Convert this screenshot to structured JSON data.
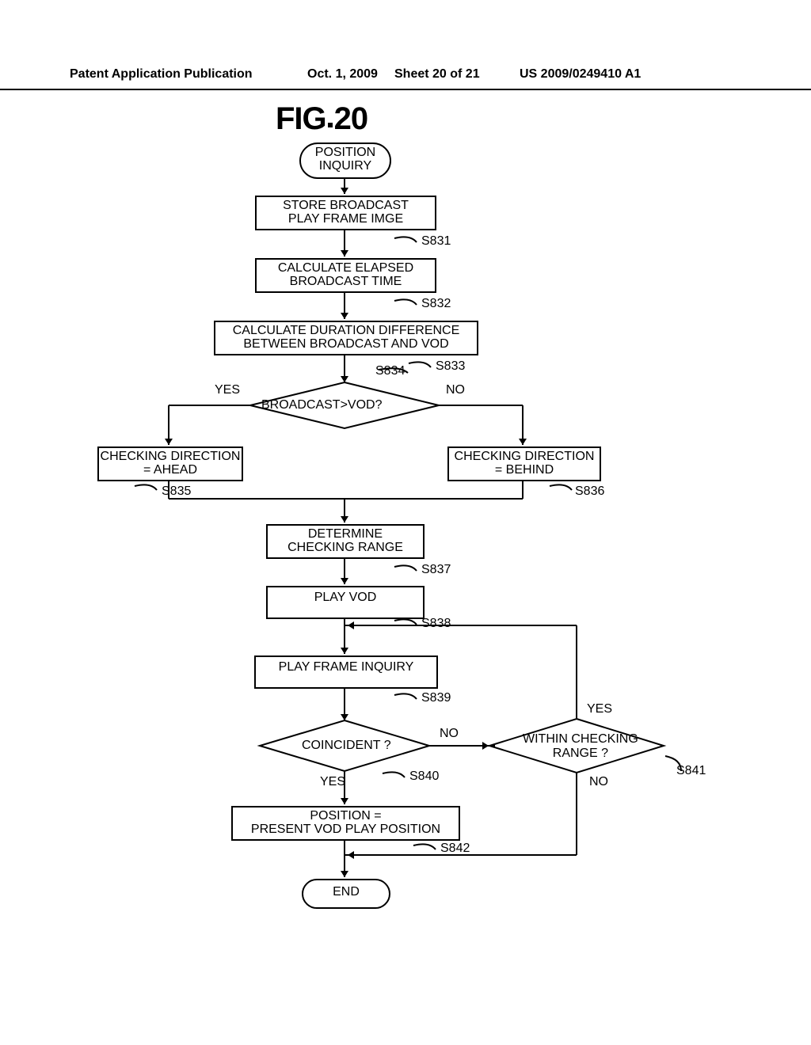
{
  "header": {
    "left": "Patent Application Publication",
    "center": "Oct. 1, 2009",
    "sheet": "Sheet 20 of 21",
    "pubno": "US 2009/0249410 A1"
  },
  "fig": {
    "prefix": "FIG",
    "num": "20"
  },
  "nodes": {
    "start": "POSITION\nINQUIRY",
    "n1": "STORE BROADCAST\nPLAY FRAME IMGE",
    "n2": "CALCULATE ELAPSED\nBROADCAST TIME",
    "n3": "CALCULATE DURATION DIFFERENCE\nBETWEEN BROADCAST AND VOD",
    "d1": "BROADCAST>VOD?",
    "n5a": "CHECKING DIRECTION\n= AHEAD",
    "n5b": "CHECKING DIRECTION\n= BEHIND",
    "n6": "DETERMINE\nCHECKING RANGE",
    "n7": "PLAY VOD",
    "n8": "PLAY FRAME INQUIRY",
    "d2": "COINCIDENT ?",
    "d3": "WITHIN CHECKING\nRANGE ?",
    "n10": "POSITION =\nPRESENT VOD PLAY POSITION",
    "end": "END"
  },
  "steplabels": {
    "s831": "S831",
    "s832": "S832",
    "s833": "S833",
    "s834": "S834",
    "s835": "S835",
    "s836": "S836",
    "s837": "S837",
    "s838": "S838",
    "s839": "S839",
    "s840": "S840",
    "s841": "S841",
    "s842": "S842"
  },
  "branch": {
    "yes": "YES",
    "no": "NO"
  }
}
